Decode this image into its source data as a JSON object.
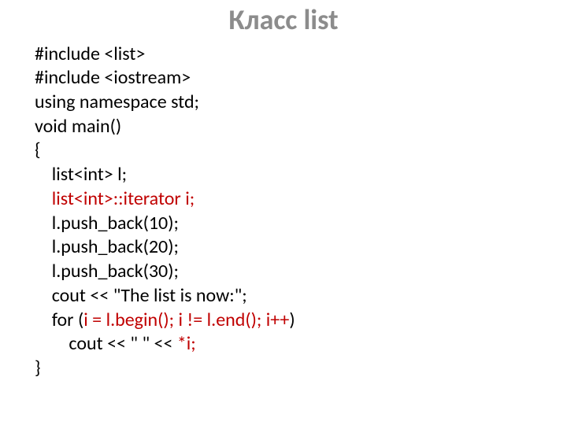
{
  "title": "Класс list",
  "code": {
    "l01": "#include <list>",
    "l02": "#include <iostream>",
    "l03": "using namespace std;",
    "l04": "void main()",
    "l05": "{",
    "l06": "    list<int> l;",
    "l07a": "    ",
    "l07b": "list<int>::iterator i;",
    "l08": "    l.push_back(10);",
    "l09": "    l.push_back(20);",
    "l10": "    l.push_back(30);",
    "l11": "    cout << \"The list is now:\";",
    "l12a": "    for (",
    "l12b": "i = l.begin(); i != l.end(); i++",
    "l12c": ")",
    "l13a": "        cout << \" \" << ",
    "l13b": "*i;",
    "l14": "}"
  }
}
